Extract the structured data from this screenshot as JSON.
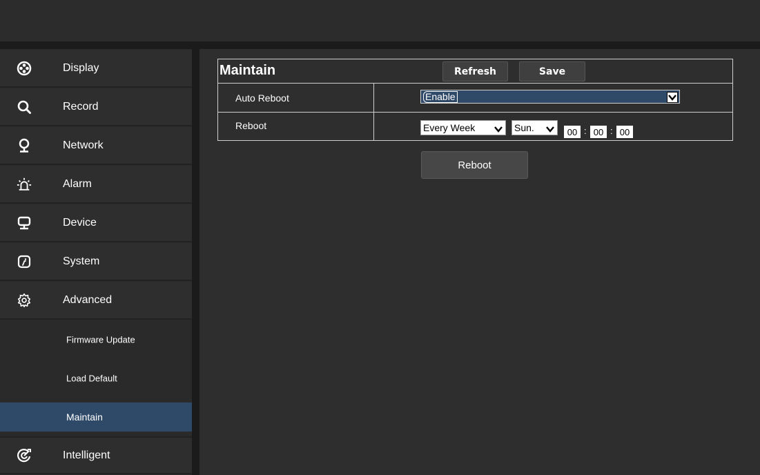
{
  "sidebar": {
    "items": [
      {
        "label": "Display",
        "icon": "display-icon"
      },
      {
        "label": "Record",
        "icon": "search-icon"
      },
      {
        "label": "Network",
        "icon": "network-icon"
      },
      {
        "label": "Alarm",
        "icon": "alarm-icon"
      },
      {
        "label": "Device",
        "icon": "monitor-icon"
      },
      {
        "label": "System",
        "icon": "system-icon"
      },
      {
        "label": "Advanced",
        "icon": "gear-icon"
      }
    ],
    "subitems": [
      {
        "label": "Firmware Update"
      },
      {
        "label": "Load Default"
      },
      {
        "label": "Maintain",
        "active": true
      }
    ],
    "last_item": {
      "label": "Intelligent",
      "icon": "intelligent-icon"
    },
    "active_color": "#2f4a68"
  },
  "panel": {
    "title": "Maintain",
    "refresh_label": "Refresh",
    "save_label": "Save",
    "auto_reboot_label": "Auto Reboot",
    "auto_reboot_value": "Enable",
    "reboot_label": "Reboot",
    "frequency_value": "Every Week",
    "day_value": "Sun.",
    "hour": "00",
    "minute": "00",
    "second": "00",
    "time_sep": ":"
  },
  "reboot_button_label": "Reboot"
}
